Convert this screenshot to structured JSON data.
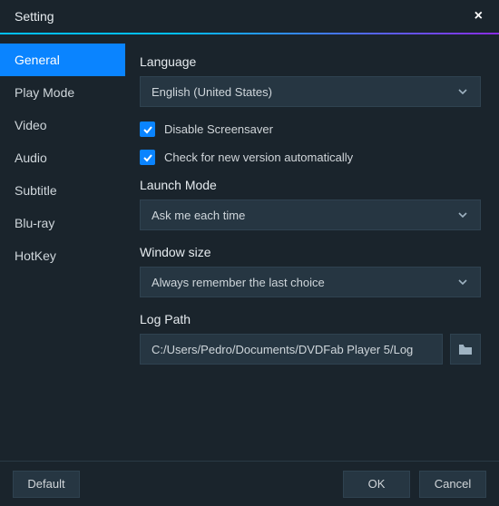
{
  "window": {
    "title": "Setting"
  },
  "sidebar": {
    "items": [
      {
        "label": "General"
      },
      {
        "label": "Play Mode"
      },
      {
        "label": "Video"
      },
      {
        "label": "Audio"
      },
      {
        "label": "Subtitle"
      },
      {
        "label": "Blu-ray"
      },
      {
        "label": "HotKey"
      }
    ]
  },
  "general": {
    "language_label": "Language",
    "language_value": "English (United States)",
    "disable_screensaver_label": "Disable Screensaver",
    "check_update_label": "Check for new version automatically",
    "launch_mode_label": "Launch Mode",
    "launch_mode_value": "Ask me each time",
    "window_size_label": "Window size",
    "window_size_value": "Always remember the last choice",
    "log_path_label": "Log Path",
    "log_path_value": "C:/Users/Pedro/Documents/DVDFab Player 5/Log"
  },
  "footer": {
    "default_label": "Default",
    "ok_label": "OK",
    "cancel_label": "Cancel"
  }
}
